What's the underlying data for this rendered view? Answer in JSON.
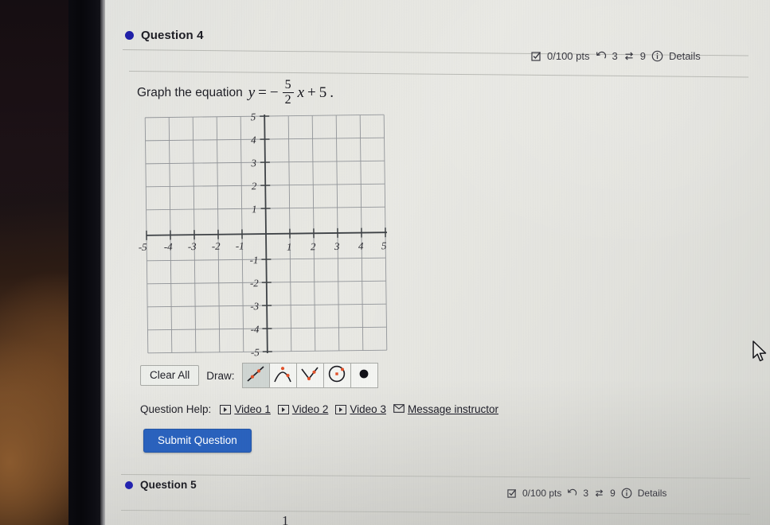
{
  "questions": [
    {
      "id": "q4",
      "title": "Question 4",
      "points": "0/100 pts",
      "attempts": "3",
      "retries": "9",
      "details": "Details",
      "icons": {
        "bullet": "filled-circle-icon",
        "points": "checkbox-icon",
        "attempts": "undo-arrow-icon",
        "retries": "swap-arrows-icon",
        "details": "info-circle-icon"
      }
    },
    {
      "id": "q5",
      "title": "Question 5",
      "points": "0/100 pts",
      "attempts": "3",
      "retries": "9",
      "details": "Details"
    }
  ],
  "prompt": {
    "lead": "Graph the equation",
    "equation": {
      "lhs": "y",
      "equals": "=",
      "sign": "−",
      "numerator": "5",
      "denominator": "2",
      "variable": "x",
      "plus": "+",
      "constant": "5",
      "period": ".",
      "plain": "y = -5/2 x + 5."
    }
  },
  "graph": {
    "x_ticks": [
      "-5",
      "-4",
      "-3",
      "-2",
      "-1",
      "1",
      "2",
      "3",
      "4",
      "5"
    ],
    "y_ticks": [
      "5",
      "4",
      "3",
      "2",
      "1",
      "-1",
      "-2",
      "-3",
      "-4",
      "-5"
    ],
    "xlim": [
      -5,
      5
    ],
    "ylim": [
      -5,
      5
    ],
    "grid": true,
    "plotted_points": [],
    "drawn_curves": []
  },
  "toolbar": {
    "clear_all": "Clear All",
    "draw_label": "Draw:",
    "tools": [
      {
        "name": "draw-line-tool",
        "icon": "line-segment-icon",
        "selected": true
      },
      {
        "name": "draw-parabola-down-tool",
        "icon": "parabola-down-icon",
        "selected": false
      },
      {
        "name": "draw-absolute-value-tool",
        "icon": "v-shape-icon",
        "selected": false
      },
      {
        "name": "draw-circle-tool",
        "icon": "circle-with-center-icon",
        "selected": false
      },
      {
        "name": "draw-point-tool",
        "icon": "filled-dot-icon",
        "selected": false
      }
    ]
  },
  "help": {
    "label": "Question Help:",
    "links": [
      {
        "text": "Video 1",
        "icon": "play-video-icon"
      },
      {
        "text": "Video 2",
        "icon": "play-video-icon"
      },
      {
        "text": "Video 3",
        "icon": "play-video-icon"
      },
      {
        "text": "Message instructor",
        "icon": "envelope-icon"
      }
    ]
  },
  "submit": {
    "label": "Submit Question"
  },
  "cut_off_text": "1",
  "colors": {
    "accent_blue": "#2a62bd",
    "bullet_blue": "#2020a8",
    "tool_point_orange": "#e2522a",
    "page_bg": "#e6e6e1",
    "grid_line": "#8e9196",
    "axis_line": "#3e4246"
  }
}
